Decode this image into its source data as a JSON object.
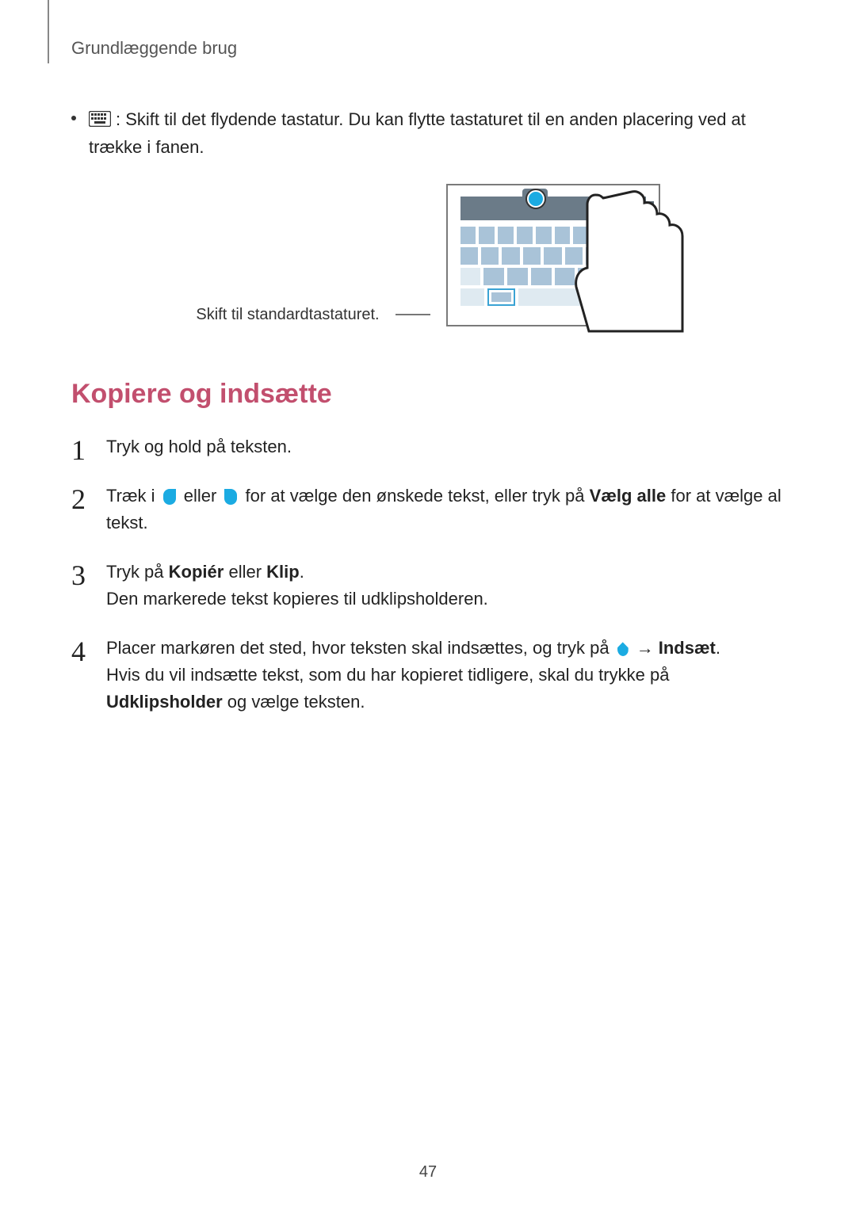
{
  "header": {
    "breadcrumb": "Grundlæggende brug"
  },
  "bullet": {
    "text_before_icon": "",
    "text_after_icon": ": Skift til det flydende tastatur. Du kan flytte tastaturet til en anden placering ved at trække i fanen."
  },
  "illustration": {
    "callout": "Skift til standardtastaturet."
  },
  "section_title": "Kopiere og indsætte",
  "steps": {
    "s1": "Tryk og hold på teksten.",
    "s2_a": "Træk i ",
    "s2_b": " eller ",
    "s2_c": " for at vælge den ønskede tekst, eller tryk på ",
    "s2_bold": "Vælg alle",
    "s2_d": " for at vælge al tekst.",
    "s3_a": "Tryk på ",
    "s3_bold1": "Kopiér",
    "s3_mid": " eller ",
    "s3_bold2": "Klip",
    "s3_end": ".",
    "s3_line2": "Den markerede tekst kopieres til udklipsholderen.",
    "s4_a": "Placer markøren det sted, hvor teksten skal indsættes, og tryk på ",
    "s4_arrow": "→",
    "s4_bold": "Indsæt",
    "s4_end": ".",
    "s4_line2a": "Hvis du vil indsætte tekst, som du har kopieret tidligere, skal du trykke på ",
    "s4_line2_bold": "Udklipsholder",
    "s4_line2b": " og vælge teksten."
  },
  "page_number": "47"
}
